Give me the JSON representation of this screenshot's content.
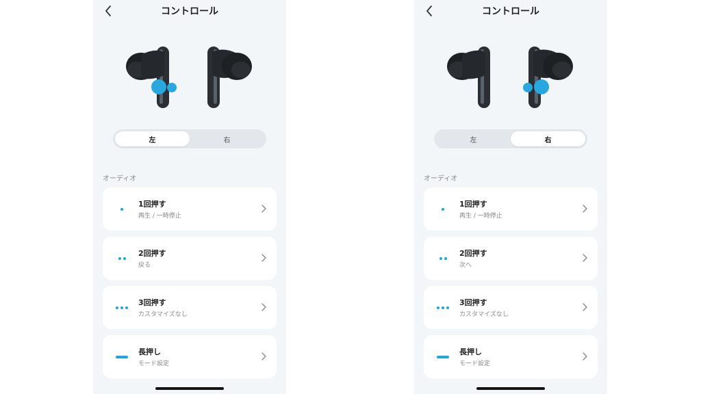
{
  "colors": {
    "accent": "#1aa7dc",
    "panel_bg": "#f3f6f9",
    "card_bg": "#ffffff"
  },
  "screens": [
    {
      "title": "コントロール",
      "tabs": {
        "left": "左",
        "right": "右",
        "selected": "left"
      },
      "section_label": "オーディオ",
      "rows": [
        {
          "title": "1回押す",
          "subtitle": "再生 / 一時停止",
          "icon": "single-dot-icon"
        },
        {
          "title": "2回押す",
          "subtitle": "戻る",
          "icon": "double-dot-icon"
        },
        {
          "title": "3回押す",
          "subtitle": "カスタマイズなし",
          "icon": "triple-dot-icon"
        },
        {
          "title": "長押し",
          "subtitle": "モード設定",
          "icon": "long-press-dash-icon"
        }
      ]
    },
    {
      "title": "コントロール",
      "tabs": {
        "left": "左",
        "right": "右",
        "selected": "right"
      },
      "section_label": "オーディオ",
      "rows": [
        {
          "title": "1回押す",
          "subtitle": "再生 / 一時停止",
          "icon": "single-dot-icon"
        },
        {
          "title": "2回押す",
          "subtitle": "次へ",
          "icon": "double-dot-icon"
        },
        {
          "title": "3回押す",
          "subtitle": "カスタマイズなし",
          "icon": "triple-dot-icon"
        },
        {
          "title": "長押し",
          "subtitle": "モード設定",
          "icon": "long-press-dash-icon"
        }
      ]
    }
  ]
}
